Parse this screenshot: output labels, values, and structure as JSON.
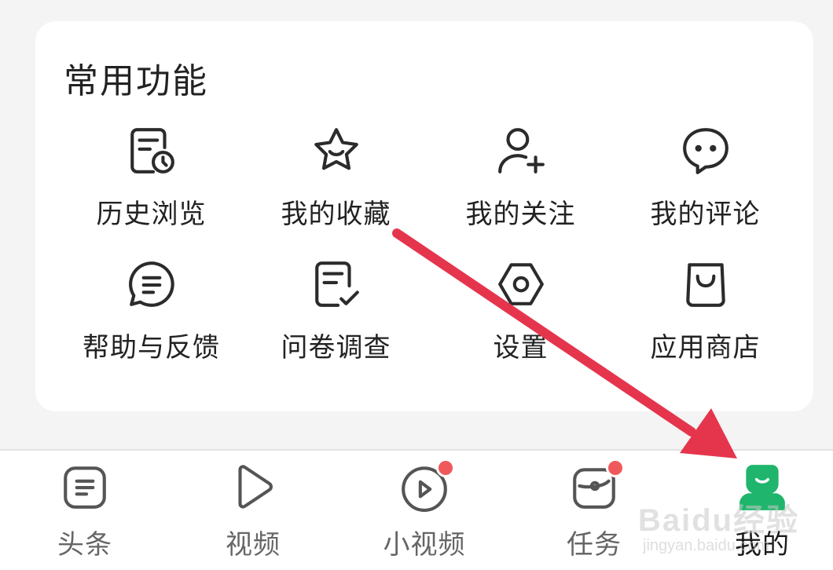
{
  "section": {
    "title": "常用功能",
    "items": [
      {
        "label": "历史浏览",
        "icon": "history-icon"
      },
      {
        "label": "我的收藏",
        "icon": "star-icon"
      },
      {
        "label": "我的关注",
        "icon": "add-user-icon"
      },
      {
        "label": "我的评论",
        "icon": "comment-icon"
      },
      {
        "label": "帮助与反馈",
        "icon": "feedback-icon"
      },
      {
        "label": "问卷调查",
        "icon": "survey-icon"
      },
      {
        "label": "设置",
        "icon": "settings-icon"
      },
      {
        "label": "应用商店",
        "icon": "shopping-bag-icon"
      }
    ]
  },
  "tabbar": {
    "tabs": [
      {
        "label": "头条",
        "icon": "headlines-icon",
        "badge": false,
        "active": false
      },
      {
        "label": "视频",
        "icon": "play-icon",
        "badge": false,
        "active": false
      },
      {
        "label": "小视频",
        "icon": "short-video-icon",
        "badge": true,
        "active": false
      },
      {
        "label": "任务",
        "icon": "task-icon",
        "badge": true,
        "active": false
      },
      {
        "label": "我的",
        "icon": "profile-icon",
        "badge": false,
        "active": true
      }
    ]
  },
  "watermark": {
    "text": "Baidu经验",
    "sub": "jingyan.baidu.com"
  },
  "colors": {
    "accent": "#1fb56c",
    "badge": "#f0595b",
    "arrow": "#e5354d",
    "icon": "#2b2b2b",
    "tab_icon": "#555555"
  }
}
